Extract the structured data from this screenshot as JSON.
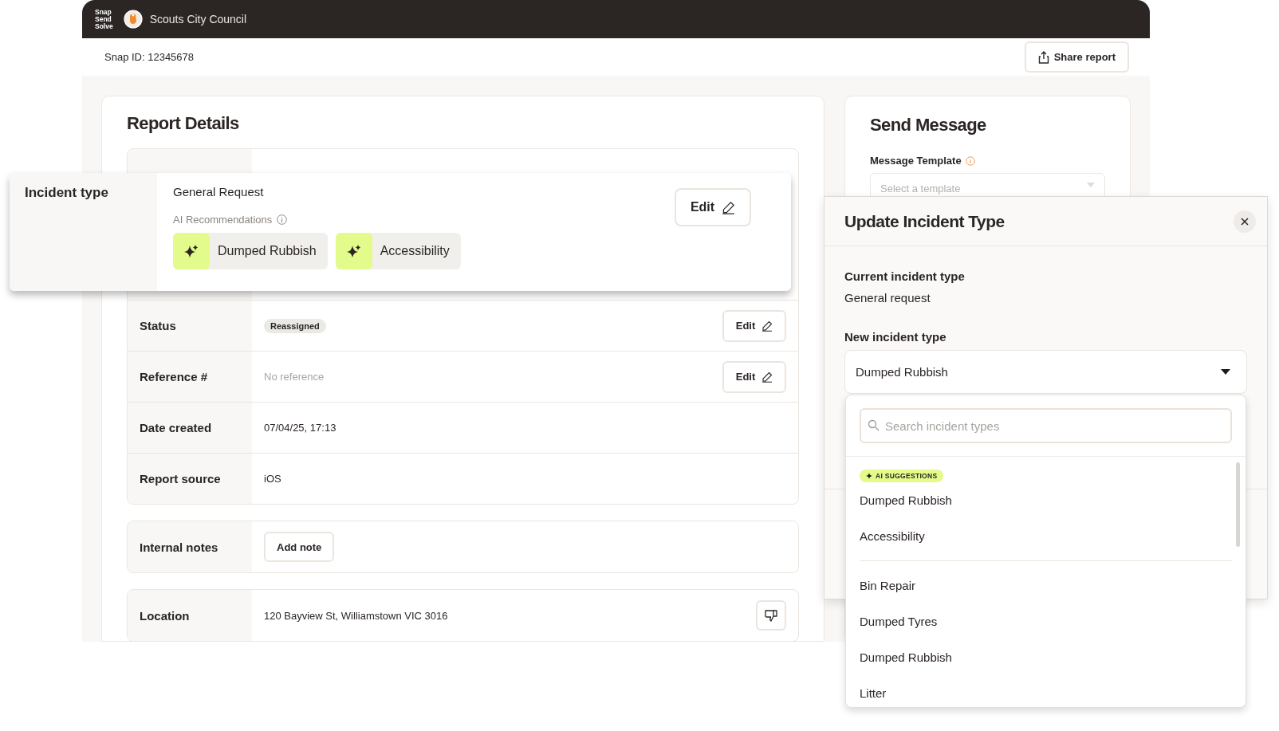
{
  "topbar": {
    "logo_lines": [
      "Snap",
      "Send",
      "Solve"
    ],
    "council": "Scouts City Council"
  },
  "snap_id": "Snap ID: 12345678",
  "share_button": "Share report",
  "report": {
    "title": "Report Details",
    "rows": [
      {
        "label": "Status",
        "kind": "badge",
        "value": "Reassigned",
        "action": "Edit"
      },
      {
        "label": "Reference #",
        "kind": "placeholder",
        "value": "No reference",
        "action": "Edit"
      },
      {
        "label": "Date created",
        "kind": "text",
        "value": "07/04/25, 17:13"
      },
      {
        "label": "Report source",
        "kind": "text",
        "value": "iOS"
      }
    ],
    "notes": {
      "label": "Internal notes",
      "button": "Add note"
    },
    "location": {
      "label": "Location",
      "value": "120 Bayview St, Williamstown VIC 3016"
    }
  },
  "incident_card": {
    "label": "Incident type",
    "value": "General Request",
    "ai_label": "AI Recommendations",
    "recommendations": [
      "Dumped Rubbish",
      "Accessibility"
    ],
    "action": "Edit"
  },
  "send_message": {
    "title": "Send Message",
    "template_label": "Message Template",
    "template_placeholder": "Select a template"
  },
  "update_panel": {
    "title": "Update Incident Type",
    "current_label": "Current incident type",
    "current_value": "General request",
    "new_label": "New incident type",
    "new_value": "Dumped Rubbish",
    "search_placeholder": "Search incident types",
    "suggestions_badge": "AI SUGGESTIONS",
    "suggestions": [
      "Dumped Rubbish",
      "Accessibility"
    ],
    "options": [
      "Bin Repair",
      "Dumped Tyres",
      "Dumped Rubbish",
      "Litter"
    ]
  }
}
